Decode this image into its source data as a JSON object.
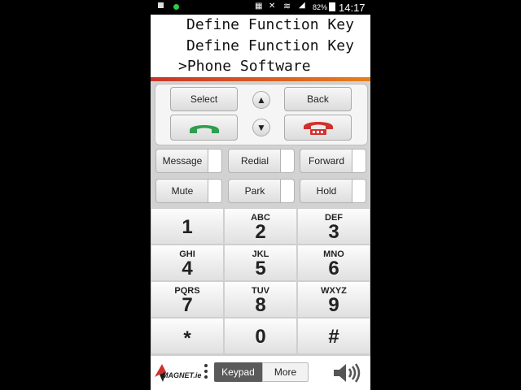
{
  "status_bar": {
    "battery": "82%",
    "time": "14:17"
  },
  "display": {
    "lines": [
      "Define Function Key",
      "Define Function Key",
      "Phone Software"
    ],
    "caret": ">"
  },
  "nav": {
    "select_label": "Select",
    "back_label": "Back",
    "up_arrow": "▲",
    "down_arrow": "▼"
  },
  "function_keys": [
    {
      "label": "Message"
    },
    {
      "label": "Redial"
    },
    {
      "label": "Forward"
    },
    {
      "label": "Mute"
    },
    {
      "label": "Park"
    },
    {
      "label": "Hold"
    }
  ],
  "keypad": [
    {
      "sub": "",
      "digit": "1"
    },
    {
      "sub": "ABC",
      "digit": "2"
    },
    {
      "sub": "DEF",
      "digit": "3"
    },
    {
      "sub": "GHI",
      "digit": "4"
    },
    {
      "sub": "JKL",
      "digit": "5"
    },
    {
      "sub": "MNO",
      "digit": "6"
    },
    {
      "sub": "PQRS",
      "digit": "7"
    },
    {
      "sub": "TUV",
      "digit": "8"
    },
    {
      "sub": "WXYZ",
      "digit": "9"
    },
    {
      "sub": "",
      "digit": "*"
    },
    {
      "sub": "",
      "digit": "0"
    },
    {
      "sub": "",
      "digit": "#"
    }
  ],
  "bottom_bar": {
    "logo_text": "MAGNET.ie",
    "tab_keypad": "Keypad",
    "tab_more": "More"
  },
  "colors": {
    "accent_start": "#c8352a",
    "accent_end": "#e77f1b",
    "call_green": "#2e9e4f",
    "hangup_red": "#d0312d"
  }
}
